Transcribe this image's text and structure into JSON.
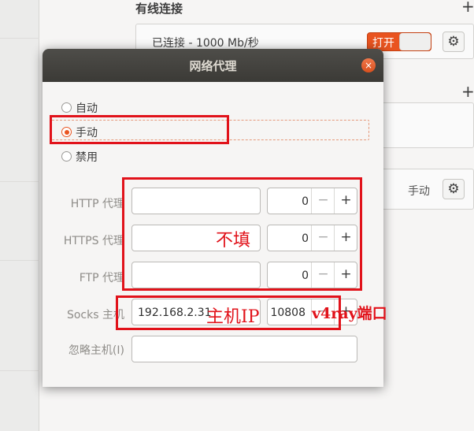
{
  "background": {
    "section_title": "有线连接",
    "connection_status": "已连接 - 1000 Mb/秒",
    "toggle_label": "打开",
    "proxy_mode": "手动",
    "plus_glyph": "+",
    "gear_glyph": "⚙"
  },
  "dialog": {
    "title": "网络代理",
    "close_glyph": "×",
    "method_options": [
      {
        "label": "自动",
        "selected": false
      },
      {
        "label": "手动",
        "selected": true
      },
      {
        "label": "禁用",
        "selected": false
      }
    ],
    "fields": [
      {
        "label": "HTTP 代理",
        "host": "",
        "port": "0"
      },
      {
        "label": "HTTPS 代理",
        "host": "",
        "port": "0"
      },
      {
        "label": "FTP 代理",
        "host": "",
        "port": "0"
      },
      {
        "label": "Socks 主机",
        "host": "192.168.2.31",
        "port": "10808"
      }
    ],
    "ignore_hosts": {
      "label": "忽略主机(I)",
      "value": ""
    },
    "minus_glyph": "−",
    "plus_glyph": "+"
  },
  "annotations": {
    "no_fill": "不填",
    "host_ip": "主机IP",
    "port_note": "v4ray端口"
  },
  "colors": {
    "accent": "#e95420",
    "annotation": "#e1121a"
  }
}
